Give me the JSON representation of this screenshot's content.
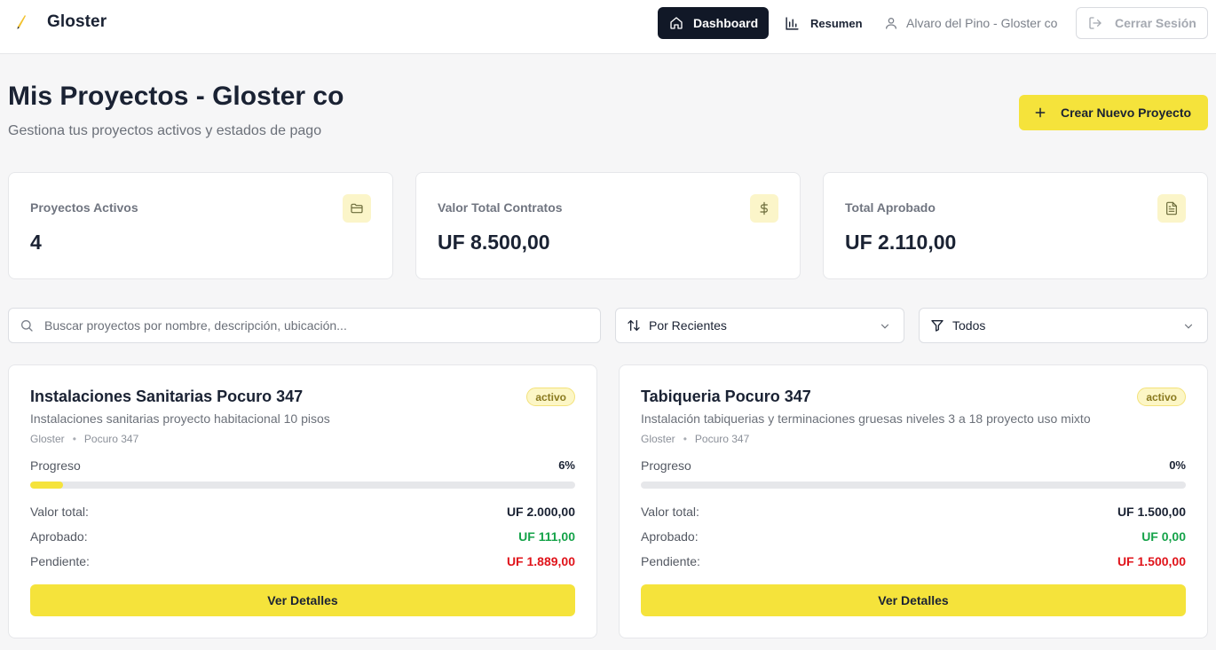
{
  "header": {
    "brand": "Gloster",
    "nav_dashboard": "Dashboard",
    "nav_resumen": "Resumen",
    "user": "Alvaro del Pino - Gloster co",
    "logout": "Cerrar Sesión"
  },
  "page": {
    "title": "Mis Proyectos - Gloster co",
    "subtitle": "Gestiona tus proyectos activos y estados de pago",
    "create_button": "Crear Nuevo Proyecto"
  },
  "stats": [
    {
      "label": "Proyectos Activos",
      "value": "4",
      "icon": "folder-icon"
    },
    {
      "label": "Valor Total Contratos",
      "value": "UF 8.500,00",
      "icon": "dollar-icon"
    },
    {
      "label": "Total Aprobado",
      "value": "UF 2.110,00",
      "icon": "document-icon"
    }
  ],
  "filters": {
    "search_placeholder": "Buscar proyectos por nombre, descripción, ubicación...",
    "sort_value": "Por Recientes",
    "status_value": "Todos"
  },
  "projects": [
    {
      "title": "Instalaciones Sanitarias Pocuro 347",
      "status": "activo",
      "description": "Instalaciones sanitarias proyecto habitacional 10 pisos",
      "company": "Gloster",
      "location": "Pocuro 347",
      "progress_label": "Progreso",
      "progress_text": "6%",
      "progress": 6,
      "total_label": "Valor total:",
      "total": "UF 2.000,00",
      "approved_label": "Aprobado:",
      "approved": "UF 111,00",
      "pending_label": "Pendiente:",
      "pending": "UF 1.889,00",
      "button": "Ver Detalles"
    },
    {
      "title": "Tabiqueria Pocuro 347",
      "status": "activo",
      "description": "Instalación tabiquerias y terminaciones gruesas niveles 3 a 18 proyecto uso mixto",
      "company": "Gloster",
      "location": "Pocuro 347",
      "progress_label": "Progreso",
      "progress_text": "0%",
      "progress": 0,
      "total_label": "Valor total:",
      "total": "UF 1.500,00",
      "approved_label": "Aprobado:",
      "approved": "UF 0,00",
      "pending_label": "Pendiente:",
      "pending": "UF 1.500,00",
      "button": "Ver Detalles"
    }
  ],
  "colors": {
    "accent": "#f5e33b",
    "dark": "#111827",
    "approved": "#16a34a",
    "pending": "#e0141b"
  }
}
